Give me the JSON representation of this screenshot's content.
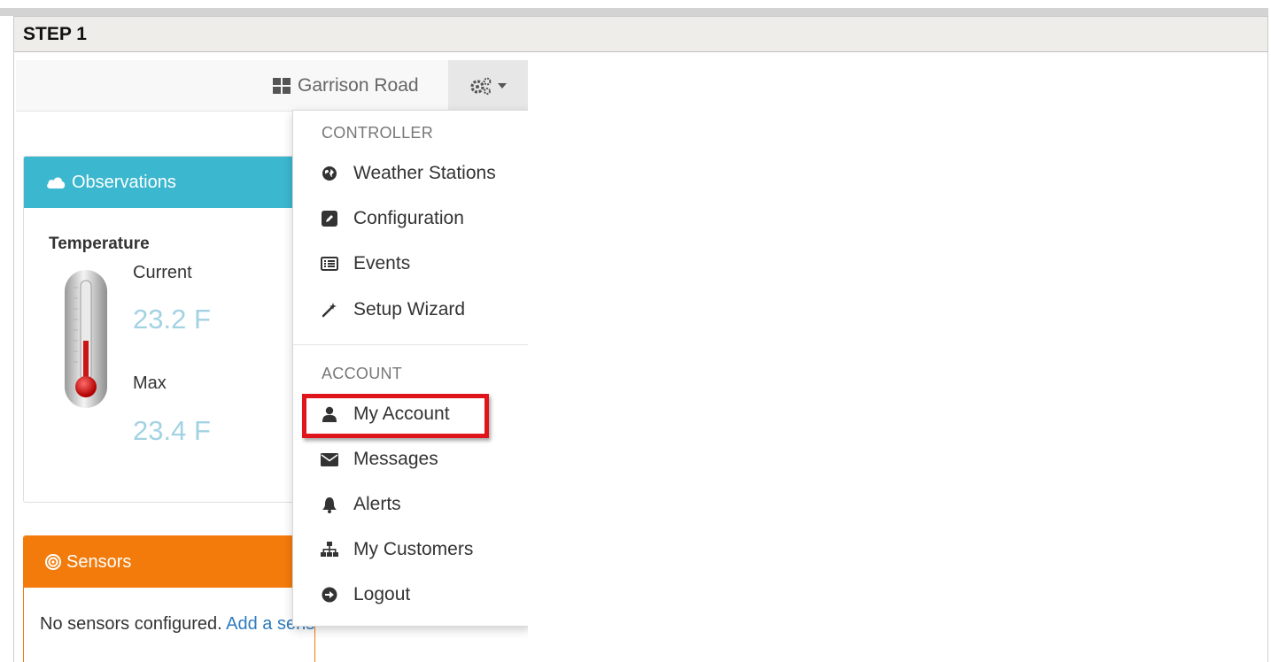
{
  "step": {
    "label": "STEP 1"
  },
  "navbar": {
    "station_name": "Garrison Road",
    "station_icon": "grid-icon",
    "settings_icon": "gears-icon",
    "caret_icon": "caret-down-icon"
  },
  "observations": {
    "title": "Observations",
    "icon": "cloud-icon",
    "temperature": {
      "label": "Temperature",
      "current_label": "Current",
      "current_value": "23.2 F",
      "max_label": "Max",
      "max_value": "23.4 F"
    }
  },
  "sensors": {
    "title": "Sensors",
    "icon": "target-icon",
    "empty_text": "No sensors configured.",
    "add_link": "Add a sensor"
  },
  "dropdown": {
    "controller_header": "CONTROLLER",
    "controller_items": [
      {
        "label": "Weather Stations",
        "icon": "globe-icon"
      },
      {
        "label": "Configuration",
        "icon": "edit-icon"
      },
      {
        "label": "Events",
        "icon": "list-icon"
      },
      {
        "label": "Setup Wizard",
        "icon": "magic-wand-icon"
      }
    ],
    "account_header": "ACCOUNT",
    "account_items": [
      {
        "label": "My Account",
        "icon": "user-icon"
      },
      {
        "label": "Messages",
        "icon": "envelope-icon"
      },
      {
        "label": "Alerts",
        "icon": "bell-icon"
      },
      {
        "label": "My Customers",
        "icon": "sitemap-icon"
      },
      {
        "label": "Logout",
        "icon": "logout-icon"
      }
    ]
  },
  "colors": {
    "observations_header": "#3bb7cf",
    "sensors_header": "#f27b0c",
    "value_text": "#a3d2e3",
    "highlight": "#e0141b",
    "link": "#2f7bbf"
  }
}
